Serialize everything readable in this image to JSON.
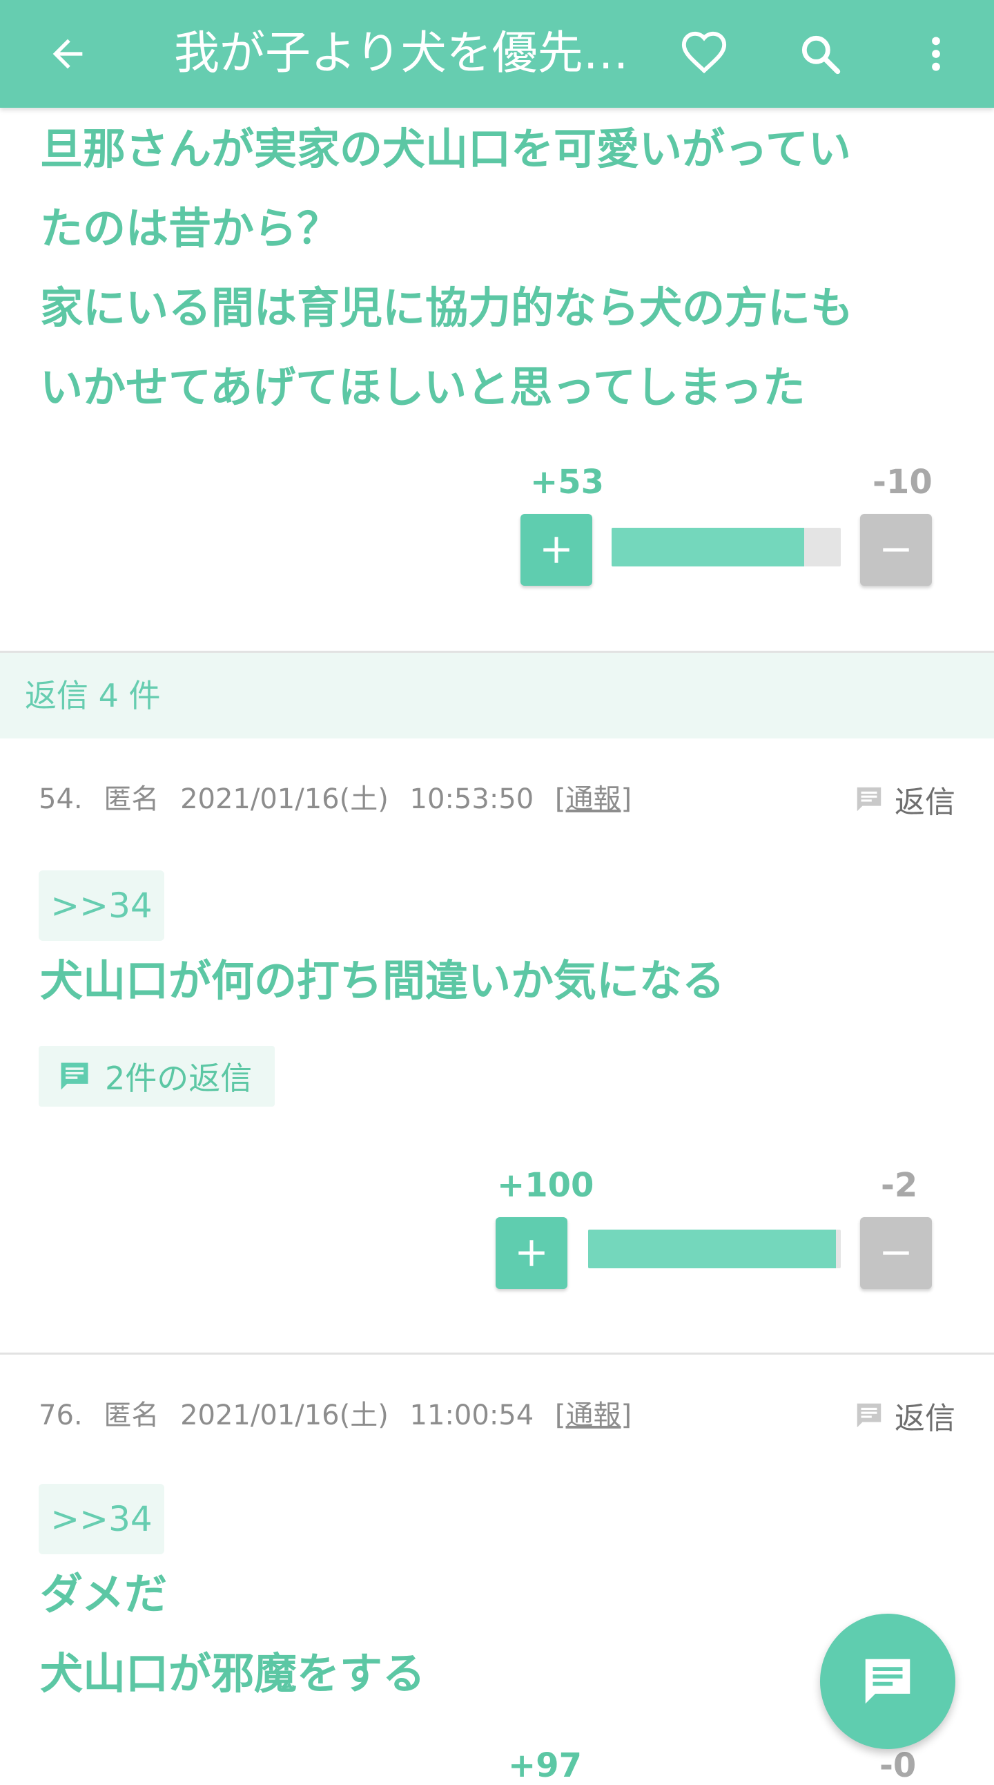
{
  "appbar": {
    "title": "我が子より犬を優先…",
    "back_icon": "arrow-left-icon",
    "favorite_icon": "heart-outline-icon",
    "search_icon": "search-icon",
    "menu_icon": "more-vertical-icon"
  },
  "colors": {
    "accent": "#5fcdaf",
    "text_accent": "#5cc7a4",
    "muted": "#8d8d8d"
  },
  "top_comment": {
    "text": "旦那さんが実家の犬山口を可愛いがってい\nたのは昔から？\n家にいる間は育児に協力的なら犬の方にも\nいかせてあげてほしいと思ってしまった",
    "plus": "+53",
    "minus": "-10",
    "ratio": 0.84
  },
  "reply_header": {
    "label": "返信 4 件"
  },
  "comments": [
    {
      "number": "54.",
      "author": "匿名",
      "date": "2021/01/16(土)",
      "time": "10:53:50",
      "report": "[通報]",
      "reply_label": "返信",
      "anchor": ">>34",
      "text": "犬山口が何の打ち間違いか気になる",
      "replies": "2件の返信",
      "plus": "+100",
      "minus": "-2",
      "ratio": 0.98
    },
    {
      "number": "76.",
      "author": "匿名",
      "date": "2021/01/16(土)",
      "time": "11:00:54",
      "report": "[通報]",
      "reply_label": "返信",
      "anchor": ">>34",
      "text": "ダメだ\n犬山口が邪魔をする",
      "plus": "+97",
      "minus": "-0"
    }
  ],
  "fab": {
    "icon": "comment-icon"
  }
}
